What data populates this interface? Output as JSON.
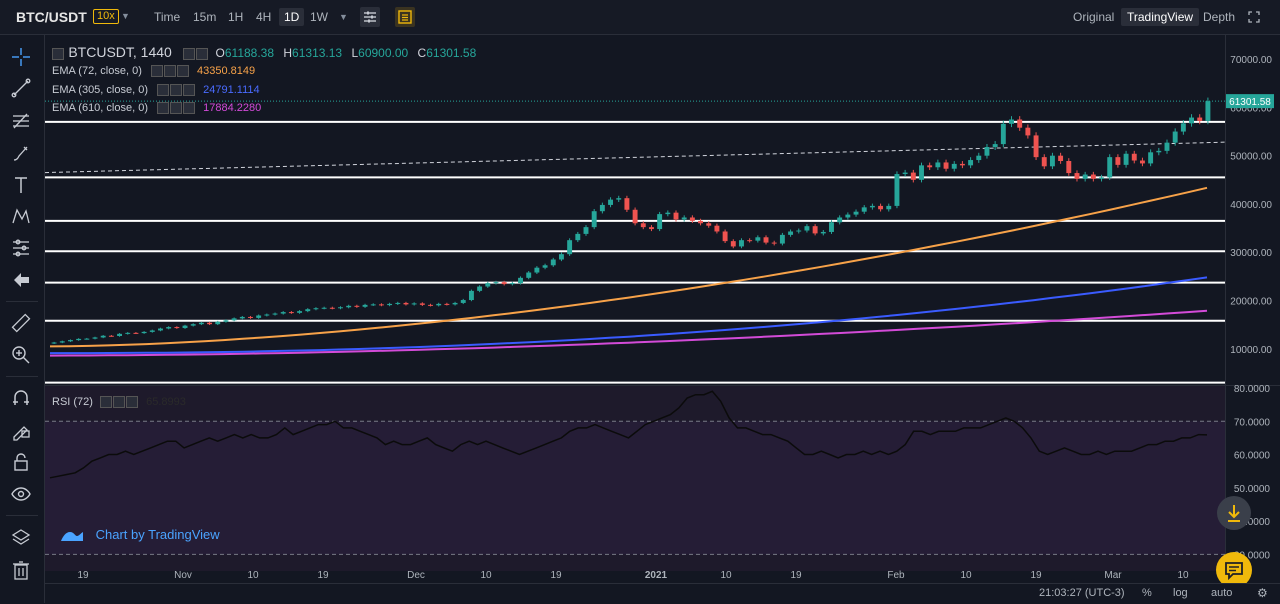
{
  "header": {
    "pair": "BTC/USDT",
    "leverage": "10x",
    "timeframes": [
      "Time",
      "15m",
      "1H",
      "4H",
      "1D",
      "1W"
    ],
    "active_timeframe": "1D",
    "views": [
      "Original",
      "TradingView",
      "Depth"
    ],
    "active_view": "TradingView"
  },
  "legend": {
    "symbol": "BTCUSDT, 1440",
    "ohlc": {
      "o_label": "O",
      "o": "61188.38",
      "h_label": "H",
      "h": "61313.13",
      "l_label": "L",
      "l": "60900.00",
      "c_label": "C",
      "c": "61301.58"
    },
    "ema": [
      {
        "label": "EMA (72, close, 0)",
        "value": "43350.8149",
        "color": "#f7a249"
      },
      {
        "label": "EMA (305, close, 0)",
        "value": "24791.1114",
        "color": "#3a5bff"
      },
      {
        "label": "EMA (610, close, 0)",
        "value": "17884.2280",
        "color": "#d34bd8"
      }
    ],
    "rsi_label": "RSI (72)",
    "rsi_value": "65.8993"
  },
  "watermark": "Chart by TradingView",
  "footer": {
    "time": "21:03:27 (UTC-3)",
    "percent": "%",
    "log": "log",
    "auto": "auto"
  },
  "colors": {
    "up": "#26a69a",
    "down": "#ef5350",
    "bg": "#131722",
    "hline": "#ffffff"
  },
  "chart_data": {
    "type": "candlestick",
    "price_axis": {
      "min": 2500,
      "max": 75000,
      "ticks": [
        "70000.00",
        "60000.00",
        "50000.00",
        "40000.00",
        "30000.00",
        "20000.00",
        "10000.00"
      ],
      "tick_values": [
        70000,
        60000,
        50000,
        40000,
        30000,
        20000,
        10000
      ]
    },
    "last_price": "61301.58",
    "x_axis_labels": [
      "19",
      "Nov",
      "10",
      "19",
      "Dec",
      "10",
      "19",
      "2021",
      "10",
      "19",
      "Feb",
      "10",
      "19",
      "Mar",
      "10"
    ],
    "horizontal_levels": [
      57000,
      45500,
      36500,
      30200,
      23700,
      15800,
      3000
    ],
    "dashed_trendline": {
      "start": 46500,
      "end": 52800
    },
    "closes": [
      11300,
      11550,
      11800,
      12050,
      12100,
      12350,
      12700,
      12650,
      13100,
      13300,
      13250,
      13500,
      13800,
      14200,
      14500,
      14300,
      14800,
      15100,
      15400,
      15100,
      15600,
      15900,
      16300,
      16600,
      16400,
      16900,
      17100,
      17300,
      17600,
      17450,
      17800,
      18200,
      18400,
      18500,
      18400,
      18600,
      18900,
      18700,
      19100,
      19200,
      19050,
      19300,
      19500,
      19200,
      19400,
      19100,
      19000,
      19300,
      19200,
      19500,
      20100,
      22000,
      22900,
      23600,
      23800,
      23400,
      23600,
      24700,
      25800,
      26800,
      27300,
      28500,
      29600,
      32500,
      33800,
      35200,
      38500,
      39800,
      40900,
      41200,
      38800,
      36000,
      35200,
      34800,
      37900,
      38200,
      36800,
      37200,
      36500,
      36000,
      35500,
      34300,
      32300,
      31200,
      32500,
      32400,
      33100,
      32000,
      31800,
      33600,
      34300,
      34500,
      35400,
      33900,
      34200,
      36200,
      37200,
      37800,
      38400,
      39300,
      39600,
      38900,
      39600,
      46200,
      46500,
      45000,
      48000,
      47600,
      48600,
      47300,
      48300,
      48000,
      49100,
      50000,
      51800,
      52400,
      56600,
      57500,
      55800,
      54200,
      49700,
      47800,
      50000,
      48900,
      46400,
      45200,
      46100,
      45200,
      45500,
      49700,
      48100,
      50400,
      49000,
      48400,
      50700,
      51000,
      52700,
      55000,
      56700,
      57900,
      57200,
      61301
    ],
    "ema72": {
      "start": 10500,
      "end": 43350
    },
    "ema305": {
      "start": 9100,
      "end": 24791
    },
    "ema610": {
      "start": 8600,
      "end": 17884
    },
    "rsi": {
      "axis_min": 25,
      "axis_max": 80,
      "ticks": [
        "80.0000",
        "70.0000",
        "60.0000",
        "50.0000",
        "40.0000",
        "30.0000"
      ],
      "tick_values": [
        80,
        70,
        60,
        50,
        40,
        30
      ],
      "upper": 70,
      "lower": 30,
      "values": [
        53,
        53.5,
        54,
        54.5,
        56,
        58,
        59,
        60,
        60,
        61,
        60,
        61,
        62,
        63,
        64,
        64,
        62,
        63,
        64,
        65,
        64,
        65,
        66,
        65,
        66,
        65,
        65,
        66,
        68,
        66,
        67,
        68,
        69,
        69,
        70,
        68,
        68,
        67,
        66,
        65,
        63,
        64,
        63,
        63,
        64,
        65,
        63,
        62,
        61,
        63,
        64,
        63,
        64,
        63,
        62,
        61,
        60,
        61,
        62,
        63,
        64,
        65,
        67,
        68,
        68,
        69,
        68,
        67,
        66,
        65,
        67,
        69,
        70,
        71,
        72,
        74,
        77,
        78,
        78,
        79,
        76,
        71,
        68,
        68,
        67,
        66,
        66,
        65,
        64,
        62,
        60,
        60,
        61,
        60,
        59,
        60,
        60,
        61,
        60,
        61,
        60,
        61,
        63,
        67,
        67,
        66,
        67,
        67,
        67,
        68,
        68,
        68,
        69,
        70,
        71,
        70,
        68,
        65,
        61,
        60,
        61,
        62,
        61,
        60,
        60,
        61,
        60,
        61,
        61,
        61,
        62,
        63,
        63,
        64,
        64,
        65,
        65,
        66,
        65.9
      ]
    }
  }
}
